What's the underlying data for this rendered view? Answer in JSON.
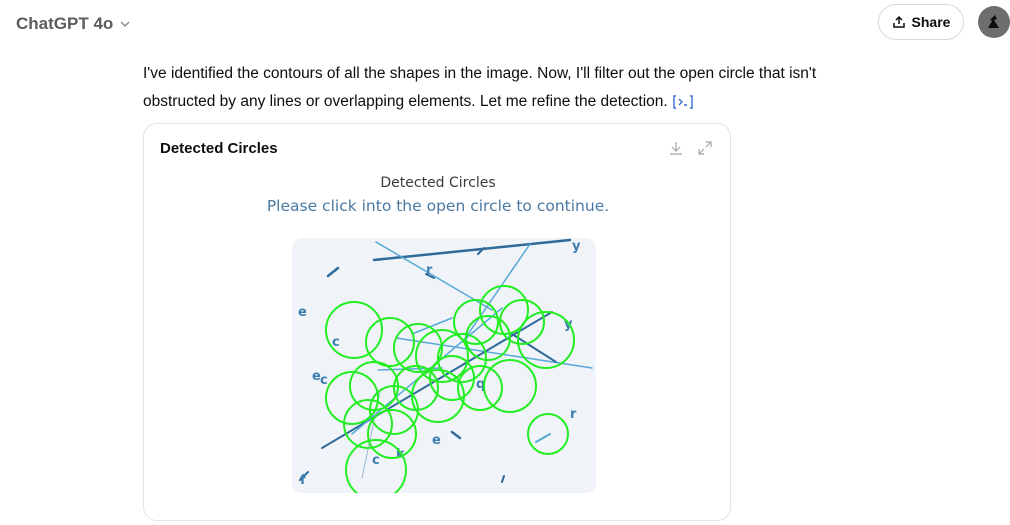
{
  "header": {
    "model_name": "ChatGPT 4o",
    "share_label": "Share"
  },
  "message": {
    "line1": "I've identified the contours of all the shapes in the image. Now, I'll filter out the open circle that isn't",
    "line2": "obstructed by any lines or overlapping elements. Let me refine the detection."
  },
  "card": {
    "title": "Detected Circles",
    "figure_title": "Detected Circles",
    "figure_subtitle": "Please click into the open circle to continue."
  },
  "colors": {
    "circle": "#22ee22",
    "line_dark": "#2f6a9a",
    "line_light": "#56a8d6",
    "plot_bg": "#f0f4f8"
  },
  "icons": [
    "chevron-down-icon",
    "share-icon",
    "avatar-icon",
    "code-citation-icon",
    "download-icon",
    "expand-icon"
  ]
}
